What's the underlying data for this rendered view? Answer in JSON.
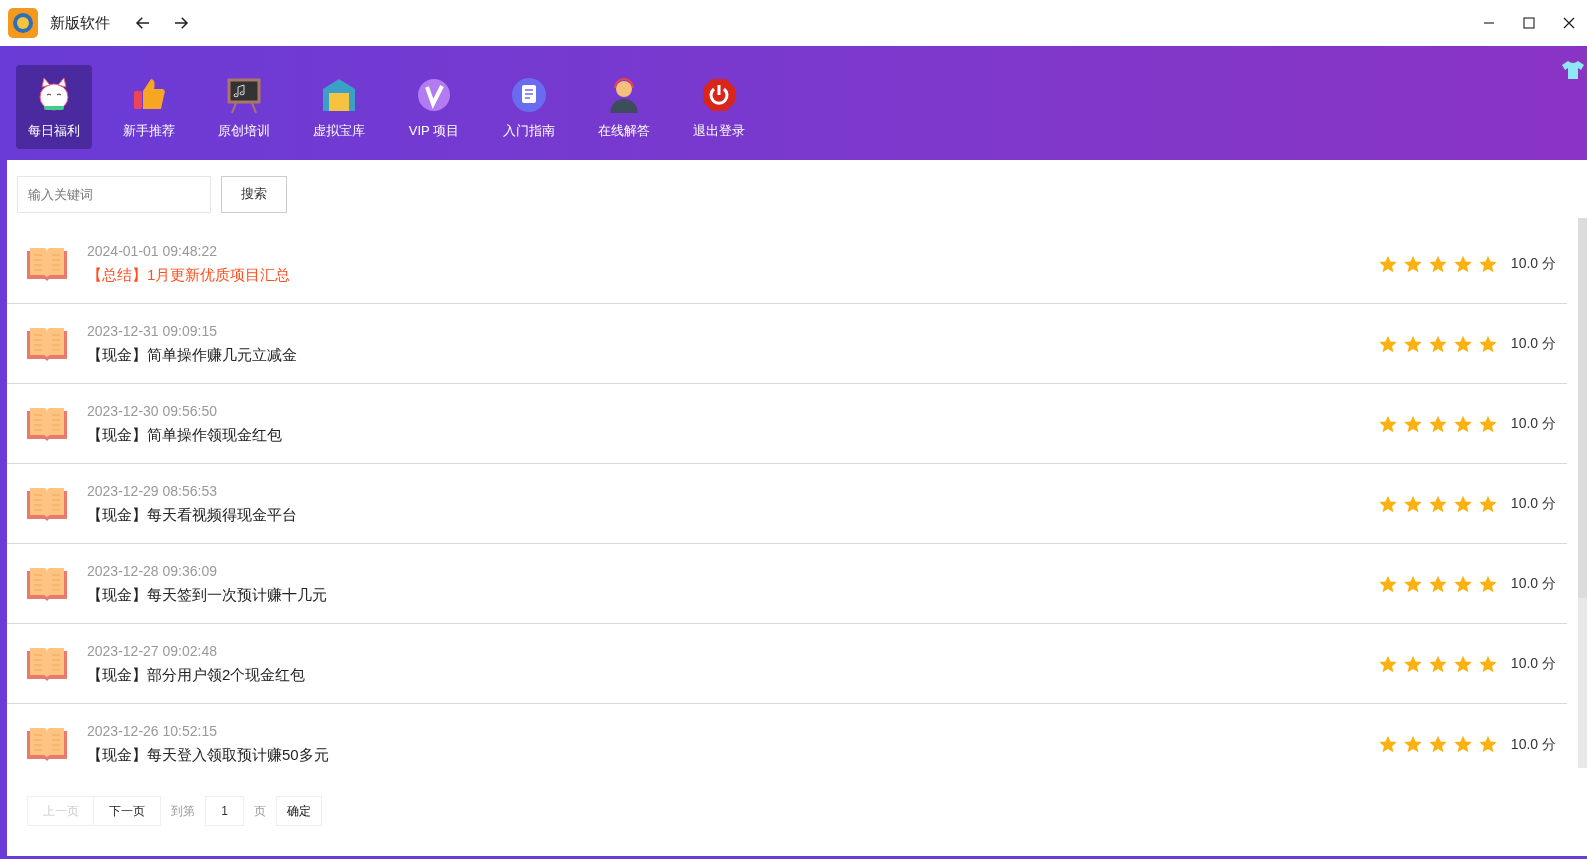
{
  "window": {
    "title": "新版软件"
  },
  "nav": [
    {
      "label": "每日福利",
      "selected": true
    },
    {
      "label": "新手推荐",
      "selected": false
    },
    {
      "label": "原创培训",
      "selected": false
    },
    {
      "label": "虚拟宝库",
      "selected": false
    },
    {
      "label": "VIP 项目",
      "selected": false
    },
    {
      "label": "入门指南",
      "selected": false
    },
    {
      "label": "在线解答",
      "selected": false
    },
    {
      "label": "退出登录",
      "selected": false
    }
  ],
  "search": {
    "placeholder": "输入关键词",
    "button": "搜索"
  },
  "list": [
    {
      "date": "2024-01-01 09:48:22",
      "title": "【总结】1月更新优质项目汇总",
      "highlighted": true,
      "stars": 5,
      "score": "10.0 分"
    },
    {
      "date": "2023-12-31 09:09:15",
      "title": "【现金】简单操作赚几元立减金",
      "highlighted": false,
      "stars": 5,
      "score": "10.0 分"
    },
    {
      "date": "2023-12-30 09:56:50",
      "title": "【现金】简单操作领现金红包",
      "highlighted": false,
      "stars": 5,
      "score": "10.0 分"
    },
    {
      "date": "2023-12-29 08:56:53",
      "title": "【现金】每天看视频得现金平台",
      "highlighted": false,
      "stars": 5,
      "score": "10.0 分"
    },
    {
      "date": "2023-12-28 09:36:09",
      "title": "【现金】每天签到一次预计赚十几元",
      "highlighted": false,
      "stars": 5,
      "score": "10.0 分"
    },
    {
      "date": "2023-12-27 09:02:48",
      "title": "【现金】部分用户领2个现金红包",
      "highlighted": false,
      "stars": 5,
      "score": "10.0 分"
    },
    {
      "date": "2023-12-26 10:52:15",
      "title": "【现金】每天登入领取预计赚50多元",
      "highlighted": false,
      "stars": 5,
      "score": "10.0 分"
    }
  ],
  "pagination": {
    "prev": {
      "label": "上一页",
      "disabled": true
    },
    "next": {
      "label": "下一页",
      "disabled": false
    },
    "goto_label": "到第",
    "page": "1",
    "page_suffix": "页",
    "confirm": "确定"
  }
}
